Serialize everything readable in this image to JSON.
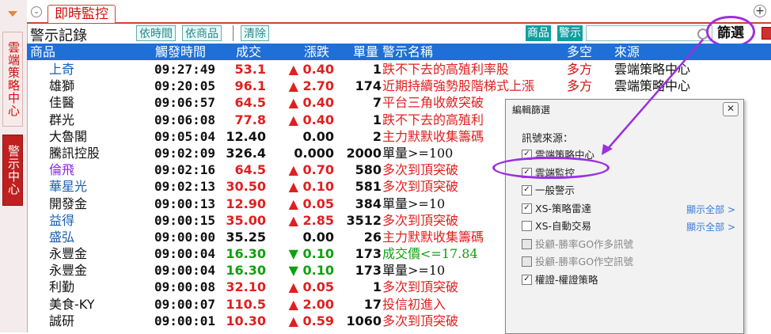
{
  "sidebar": {
    "tabs": [
      {
        "label": "雲端策略中心"
      },
      {
        "label": "警示中心"
      }
    ]
  },
  "panel": {
    "tab_label": "即時監控",
    "title": "警示記錄",
    "btn_by_time": "依時間",
    "btn_by_product": "依商品",
    "btn_clear": "清除",
    "btn_product": "商品",
    "btn_alert": "警示",
    "btn_filter": "篩選"
  },
  "columns": [
    "商品",
    "觸發時間",
    "成交",
    "漲跌",
    "單量",
    "警示名稱",
    "多空",
    "來源"
  ],
  "rows": [
    {
      "name": "上奇",
      "name_color": "#1a5fb4",
      "time": "09:27:49",
      "price": "53.1",
      "price_color": "#e02020",
      "chg": "0.40",
      "dir": "up",
      "vol": "1",
      "alert": "跌不下去的高殖利率股",
      "alert_color": "#e02020",
      "side": "多方",
      "src": "雲端策略中心"
    },
    {
      "name": "雄獅",
      "name_color": "#111111",
      "time": "09:20:05",
      "price": "96.1",
      "price_color": "#e02020",
      "chg": "2.70",
      "dir": "up",
      "vol": "174",
      "alert": "近期持續強勢股階梯式上漲",
      "alert_color": "#e02020",
      "side": "多方",
      "src": "雲端策略中心"
    },
    {
      "name": "佳醫",
      "name_color": "#111111",
      "time": "09:06:57",
      "price": "64.5",
      "price_color": "#e02020",
      "chg": "0.40",
      "dir": "up",
      "vol": "7",
      "alert": "平台三角收斂突破",
      "alert_color": "#e02020",
      "side": "",
      "src": ""
    },
    {
      "name": "群光",
      "name_color": "#111111",
      "time": "09:06:08",
      "price": "77.8",
      "price_color": "#e02020",
      "chg": "0.40",
      "dir": "up",
      "vol": "1",
      "alert": "跌不下去的高殖利",
      "alert_color": "#e02020",
      "side": "",
      "src": ""
    },
    {
      "name": "大魯閣",
      "name_color": "#111111",
      "time": "09:05:04",
      "price": "12.40",
      "price_color": "#111111",
      "chg": "0.00",
      "dir": "flat",
      "vol": "2",
      "alert": "主力默默收集籌碼",
      "alert_color": "#e02020",
      "side": "",
      "src": ""
    },
    {
      "name": "騰訊控股",
      "name_color": "#111111",
      "time": "09:02:09",
      "price": "326.4",
      "price_color": "#111111",
      "chg": "0.000",
      "dir": "flat",
      "vol": "2000",
      "alert": "單量>=100",
      "alert_color": "#111111",
      "side": "",
      "src": ""
    },
    {
      "name": "倫飛",
      "name_color": "#8a2be2",
      "time": "09:02:16",
      "price": "64.5",
      "price_color": "#e02020",
      "chg": "0.70",
      "dir": "up",
      "vol": "580",
      "alert": "多次到頂突破",
      "alert_color": "#e02020",
      "side": "",
      "src": ""
    },
    {
      "name": "華星光",
      "name_color": "#1a5fb4",
      "time": "09:02:13",
      "price": "30.50",
      "price_color": "#e02020",
      "chg": "0.10",
      "dir": "up",
      "vol": "581",
      "alert": "多次到頂突破",
      "alert_color": "#e02020",
      "side": "",
      "src": ""
    },
    {
      "name": "開發金",
      "name_color": "#111111",
      "time": "09:00:13",
      "price": "12.90",
      "price_color": "#e02020",
      "chg": "0.05",
      "dir": "up",
      "vol": "384",
      "alert": "單量>=10",
      "alert_color": "#111111",
      "side": "",
      "src": ""
    },
    {
      "name": "益得",
      "name_color": "#1a5fb4",
      "time": "09:00:15",
      "price": "35.00",
      "price_color": "#e02020",
      "chg": "2.85",
      "dir": "up",
      "vol": "3512",
      "alert": "多次到頂突破",
      "alert_color": "#e02020",
      "side": "",
      "src": ""
    },
    {
      "name": "盛弘",
      "name_color": "#1a5fb4",
      "time": "09:00:00",
      "price": "35.25",
      "price_color": "#111111",
      "chg": "0.00",
      "dir": "flat",
      "vol": "26",
      "alert": "主力默默收集籌碼",
      "alert_color": "#e02020",
      "side": "",
      "src": ""
    },
    {
      "name": "永豐金",
      "name_color": "#111111",
      "time": "09:00:04",
      "price": "16.30",
      "price_color": "#10a010",
      "chg": "0.10",
      "dir": "down",
      "vol": "173",
      "alert": "成交價<=17.84",
      "alert_color": "#10a010",
      "side": "",
      "src": ""
    },
    {
      "name": "永豐金",
      "name_color": "#111111",
      "time": "09:00:04",
      "price": "16.30",
      "price_color": "#10a010",
      "chg": "0.10",
      "dir": "down",
      "vol": "173",
      "alert": "單量>=10",
      "alert_color": "#111111",
      "side": "",
      "src": ""
    },
    {
      "name": "利勤",
      "name_color": "#111111",
      "time": "09:00:08",
      "price": "32.10",
      "price_color": "#e02020",
      "chg": "0.05",
      "dir": "up",
      "vol": "1",
      "alert": "多次到頂突破",
      "alert_color": "#e02020",
      "side": "",
      "src": ""
    },
    {
      "name": "美食-KY",
      "name_color": "#111111",
      "time": "09:00:07",
      "price": "110.5",
      "price_color": "#e02020",
      "chg": "2.00",
      "dir": "up",
      "vol": "17",
      "alert": "投信初進入",
      "alert_color": "#e02020",
      "side": "",
      "src": ""
    },
    {
      "name": "誠研",
      "name_color": "#111111",
      "time": "09:00:01",
      "price": "10.30",
      "price_color": "#e02020",
      "chg": "0.59",
      "dir": "up",
      "vol": "1060",
      "alert": "多次到頂突破",
      "alert_color": "#e02020",
      "side": "",
      "src": ""
    }
  ],
  "dialog": {
    "title": "編輯篩選",
    "label": "訊號來源：",
    "options": [
      {
        "label": "雲端策略中心",
        "checked": true,
        "disabled": false,
        "show_all": ""
      },
      {
        "label": "雲端監控",
        "checked": true,
        "disabled": false,
        "show_all": ""
      },
      {
        "label": "一般警示",
        "checked": true,
        "disabled": false,
        "show_all": ""
      },
      {
        "label": "XS-策略雷達",
        "checked": true,
        "disabled": false,
        "show_all": "顯示全部 >"
      },
      {
        "label": "XS-自動交易",
        "checked": false,
        "disabled": false,
        "show_all": "顯示全部 >"
      },
      {
        "label": "投顧-勝率GO作多訊號",
        "checked": false,
        "disabled": true,
        "show_all": ""
      },
      {
        "label": "投顧-勝率GO作空訊號",
        "checked": false,
        "disabled": true,
        "show_all": ""
      },
      {
        "label": "權證-權證策略",
        "checked": true,
        "disabled": false,
        "show_all": ""
      }
    ]
  },
  "colors": {
    "header_blue": "#1e6fd8",
    "up_red": "#e02020",
    "down_green": "#10a010",
    "highlight_purple": "#9b30e0"
  }
}
